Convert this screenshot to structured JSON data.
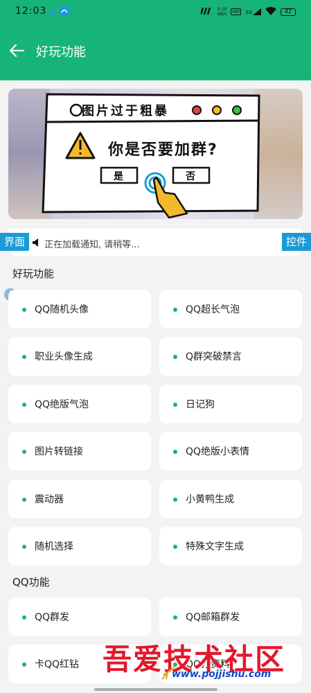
{
  "status_bar": {
    "time": "12:03",
    "net_speed_value": "0.10",
    "net_speed_unit": "KB/s",
    "hd": "HD",
    "signal_label": "5G",
    "battery": "42"
  },
  "app_bar": {
    "title": "好玩功能",
    "background": "#17b47a"
  },
  "banner": {
    "dialog_title": "图片过于粗暴",
    "question": "你是否要加群?",
    "yes": "是",
    "no": "否"
  },
  "notice": {
    "text": "正在加载通知, 请稍等...",
    "left_tag": "界面",
    "right_tag": "控件",
    "tag_color": "#1a9bd5"
  },
  "sections": [
    {
      "title": "好玩功能",
      "items": [
        "QQ随机头像",
        "QQ超长气泡",
        "职业头像生成",
        "Q群突破禁言",
        "QQ绝版气泡",
        "日记狗",
        "图片转链接",
        "QQ绝版小表情",
        "震动器",
        "小黄鸭生成",
        "随机选择",
        "特殊文字生成"
      ]
    },
    {
      "title": "QQ功能",
      "items": [
        "QQ群发",
        "QQ邮箱群发",
        "卡QQ红钻",
        "QQ打资料"
      ]
    }
  ],
  "watermark": {
    "text": "吾爱技术社区",
    "url": "www.pojjishu.com"
  }
}
